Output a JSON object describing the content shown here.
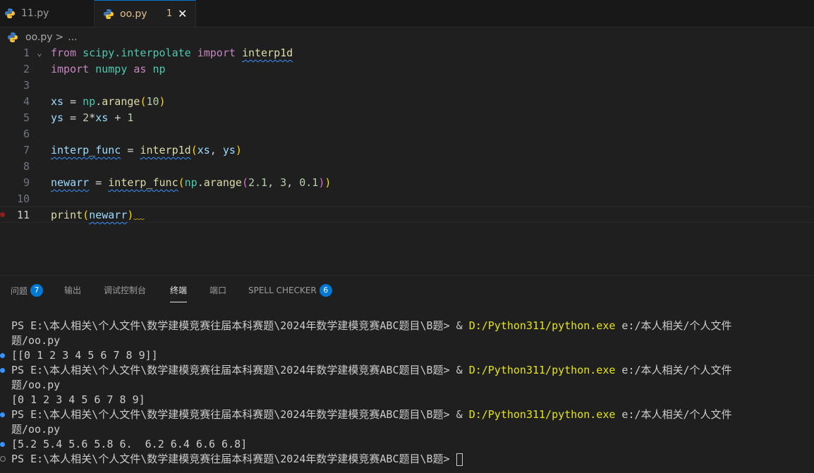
{
  "tabs": [
    {
      "label": "11.py",
      "active": false
    },
    {
      "label": "oo.py",
      "active": true,
      "problems": "1"
    }
  ],
  "breadcrumb": {
    "file": "oo.py",
    "sep": ">",
    "rest": "..."
  },
  "editor": {
    "line_numbers": [
      "1",
      "2",
      "3",
      "4",
      "5",
      "6",
      "7",
      "8",
      "9",
      "10",
      "11"
    ],
    "current_line": "11"
  },
  "panel": {
    "tabs": [
      {
        "label": "问题",
        "count": "7"
      },
      {
        "label": "输出"
      },
      {
        "label": "调试控制台"
      },
      {
        "label": "终端"
      },
      {
        "label": "端口"
      },
      {
        "label": "SPELL CHECKER",
        "count": "6"
      }
    ]
  },
  "terminal": {
    "prompt": "PS E:\\本人相关\\个人文件\\数学建模竞赛往届本科赛题\\2024年数学建模竞赛ABC题目\\B题> ",
    "amp": "& ",
    "exe": "D:/Python311/python.exe",
    "arg": " e:/本人相关/个人文件",
    "wrap": "题/oo.py",
    "out1": "[[0 1 2 3 4 5 6 7 8 9]]",
    "out2": "[0 1 2 3 4 5 6 7 8 9]",
    "out3": "[5.2 5.4 5.6 5.8 6.  6.2 6.4 6.6 6.8]"
  },
  "colors": {
    "accent": "#0078d4",
    "tab_modified": "#e2c08d",
    "terminal_exe": "#e5e510"
  }
}
